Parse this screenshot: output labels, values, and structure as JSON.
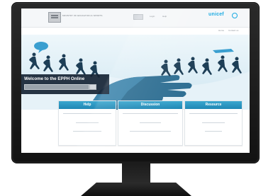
{
  "header": {
    "org_name": "MINISTRY OF EDUCATION & SPORTS",
    "search_button": "Go",
    "links": [
      "Login",
      "Help"
    ],
    "brand": "unicef"
  },
  "subnav": {
    "links": [
      "Home",
      "Contact us"
    ]
  },
  "welcome": {
    "title": "Welcome to the EPPH Online"
  },
  "cards": [
    {
      "title": "Help"
    },
    {
      "title": "Discussion"
    },
    {
      "title": "Resource"
    }
  ],
  "colors": {
    "accent": "#1f86b4",
    "sky": "#dff0f7",
    "hand": "#2f6f93",
    "brand": "#1cabe2"
  },
  "icons": {
    "logo": "crest-icon",
    "search": "search-icon",
    "brand_icon": "globe-icon"
  }
}
